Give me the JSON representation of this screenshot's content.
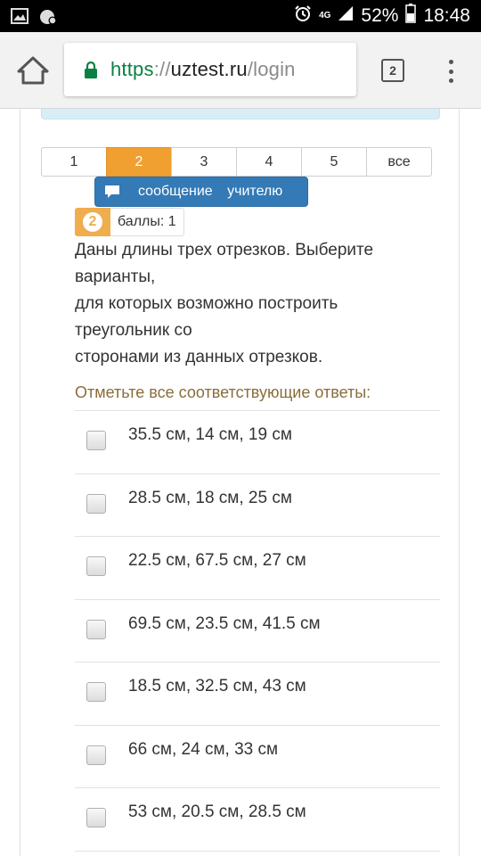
{
  "status_bar": {
    "network": "4G",
    "battery": "52%",
    "time": "18:48",
    "icons": [
      "image-icon",
      "notification-icon",
      "alarm-icon",
      "signal-icon",
      "battery-icon"
    ]
  },
  "browser": {
    "url_scheme": "https",
    "url_sep": "://",
    "url_host": "uztest.ru",
    "url_path": "/login",
    "tab_count": "2"
  },
  "pagination": {
    "items": [
      "1",
      "2",
      "3",
      "4",
      "5",
      "все"
    ],
    "active_index": 1
  },
  "message_button": {
    "label": "сообщение учителю"
  },
  "score": {
    "number": "2",
    "label": "баллы: 1"
  },
  "question": {
    "lines": [
      "Даны длины трех отрезков. Выберите",
      "варианты,",
      "для которых возможно построить",
      "треугольник со",
      "сторонами из данных отрезков."
    ]
  },
  "instruction": "Отметьте все соответствующие ответы:",
  "answers": [
    "35.5 см, 14 см, 19 см",
    "28.5 см, 18 см, 25 см",
    "22.5 см, 67.5 см, 27 см",
    "69.5 см, 23.5 см, 41.5 см",
    "18.5 см, 32.5 см, 43 см",
    "66 см, 24 см, 33 см",
    "53 см, 20.5 см, 28.5 см"
  ],
  "colors": {
    "active_page": "#f0a030",
    "message_button": "#337ab7",
    "score_badge": "#f0ad4e",
    "instruction_text": "#8a6d3b",
    "url_scheme": "#0b8043"
  }
}
